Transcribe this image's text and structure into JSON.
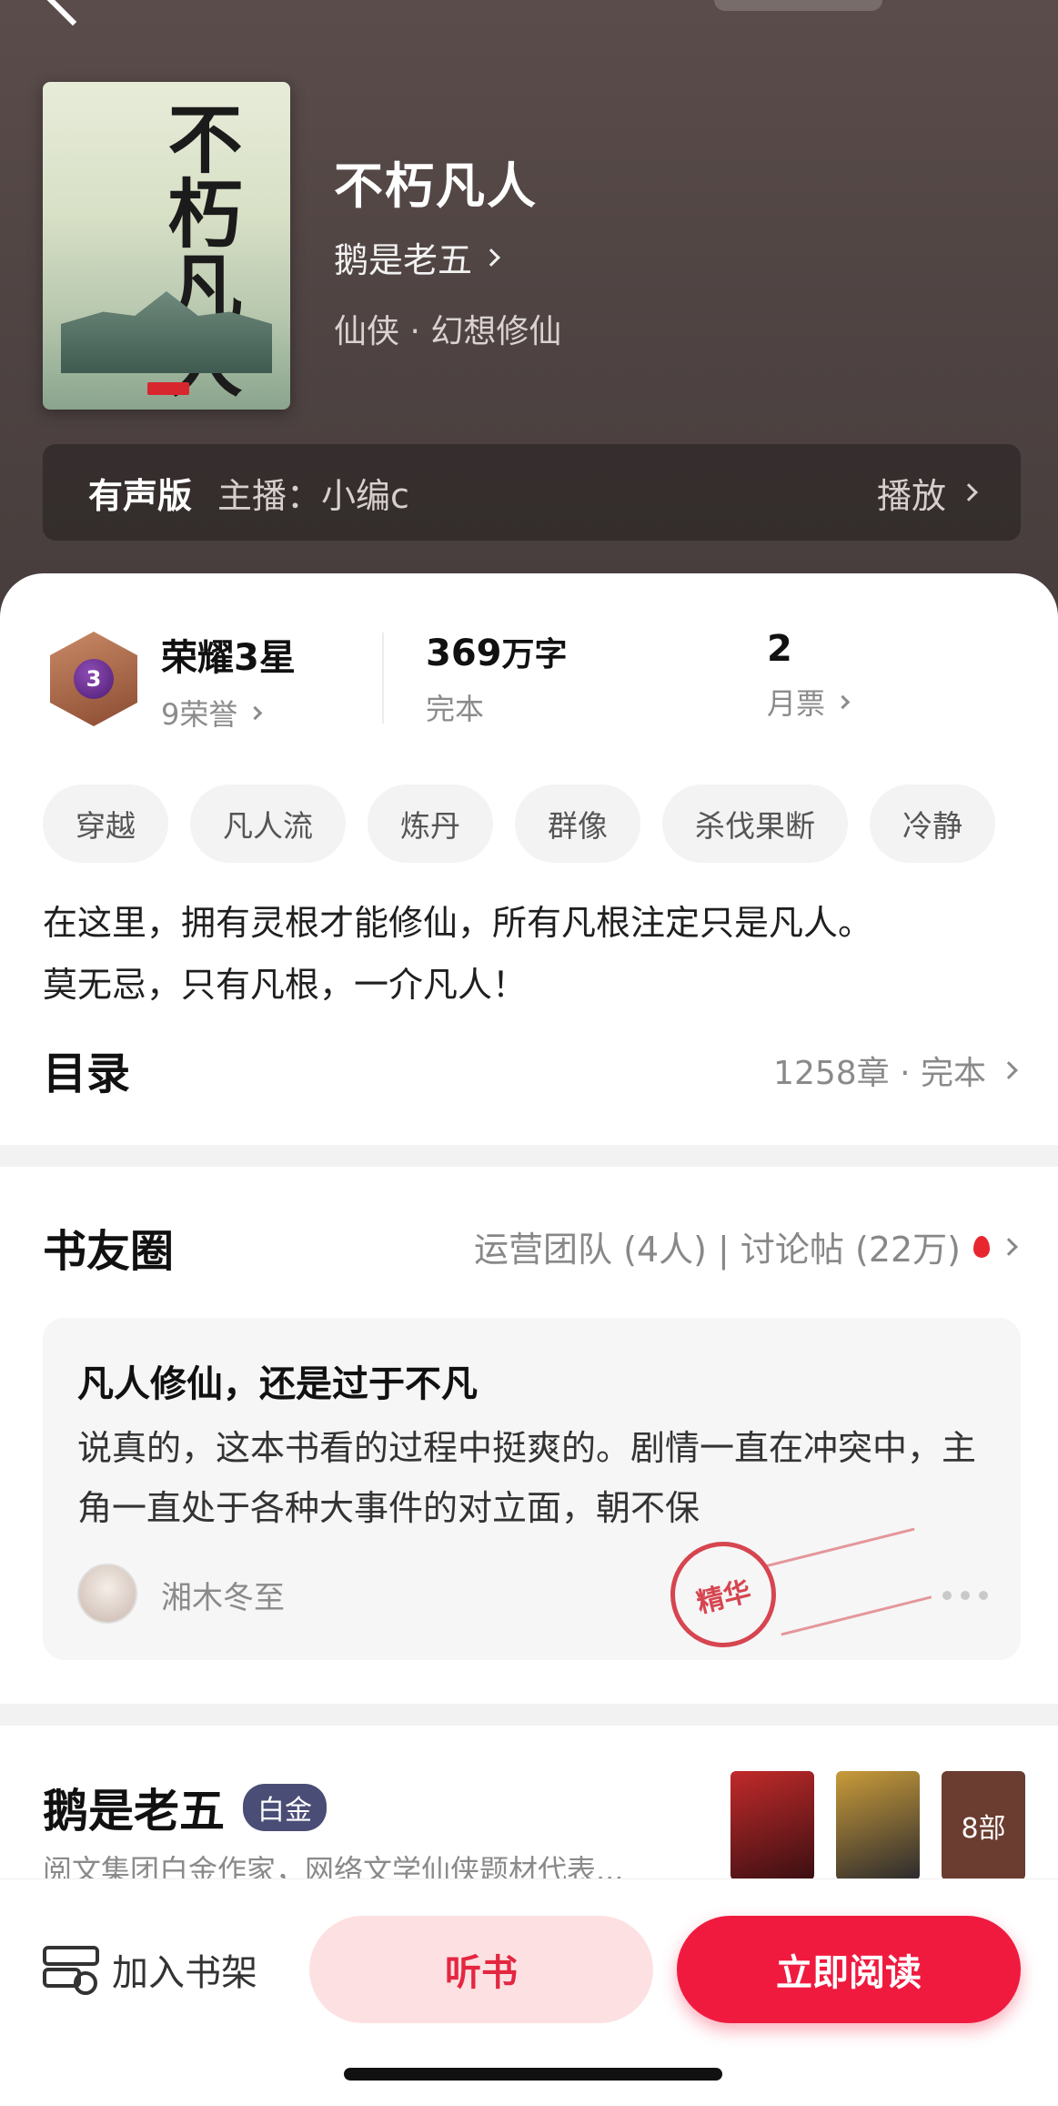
{
  "header": {
    "top_pill": ""
  },
  "book": {
    "cover_title": "不朽凡人",
    "title": "不朽凡人",
    "author": "鹅是老五",
    "genre": "仙侠 · 幻想修仙"
  },
  "audio": {
    "label": "有声版",
    "host": "主播：小编c",
    "play": "播放"
  },
  "stats": {
    "honor_level": "3",
    "honor_title": "荣耀3星",
    "honor_sub": "9荣誉",
    "words_number": "369",
    "words_unit": "万字",
    "words_sub": "完本",
    "tickets": "2",
    "tickets_sub": "月票"
  },
  "tags": [
    "穿越",
    "凡人流",
    "炼丹",
    "群像",
    "杀伐果断",
    "冷静"
  ],
  "description": {
    "line1": "在这里，拥有灵根才能修仙，所有凡根注定只是凡人。",
    "line2": "莫无忌，只有凡根，一介凡人！"
  },
  "toc": {
    "title": "目录",
    "meta": "1258章 · 完本"
  },
  "circle": {
    "title": "书友圈",
    "meta": "运营团队 (4人) | 讨论帖 (22万)",
    "post": {
      "title": "凡人修仙，还是过于不凡",
      "body": "说真的，这本书看的过程中挺爽的。剧情一直在冲突中，主角一直处于各种大事件的对立面，朝不保",
      "user": "湘木冬至",
      "stamp": "精华"
    }
  },
  "author": {
    "name": "鹅是老五",
    "badge": "白金",
    "desc": "阅文集团白金作家，网络文学仙侠题材代表...",
    "works_count": "8部"
  },
  "bottom": {
    "shelf": "加入书架",
    "listen": "听书",
    "read": "立即阅读"
  },
  "colors": {
    "accent": "#f01a3f",
    "hero_bg": "#4e4342"
  }
}
